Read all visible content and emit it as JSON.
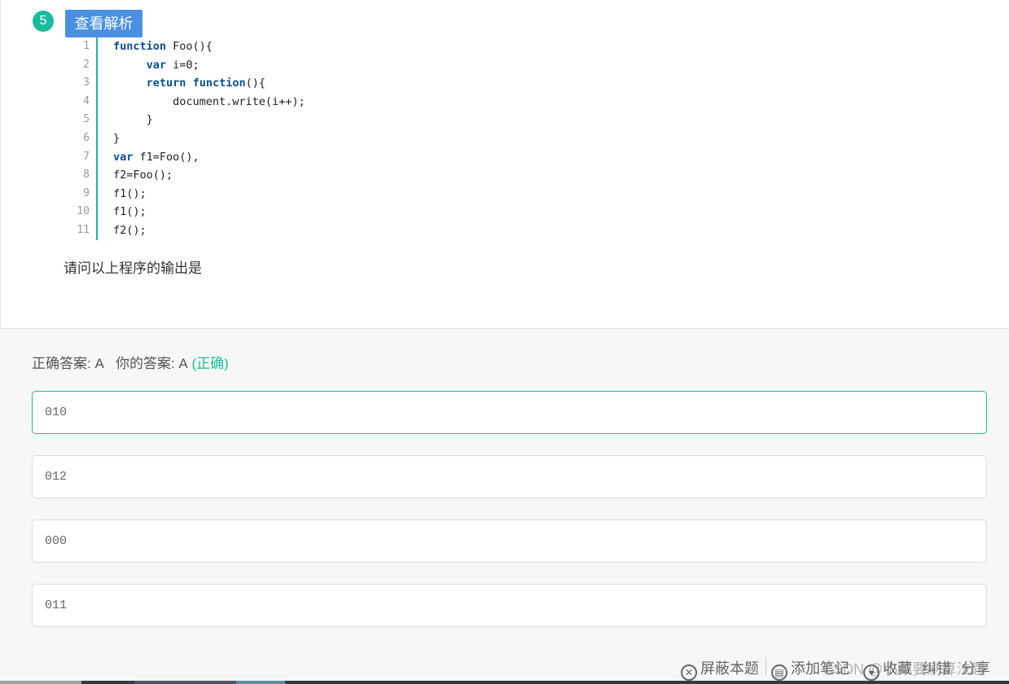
{
  "question": {
    "number": "5",
    "analysis_button": "查看解析",
    "code_line_numbers": [
      "1",
      "2",
      "3",
      "4",
      "5",
      "6",
      "7",
      "8",
      "9",
      "10",
      "11"
    ],
    "code": [
      [
        {
          "t": "function",
          "k": true
        },
        {
          "t": " Foo(){",
          "k": false
        }
      ],
      [
        {
          "t": "     ",
          "k": false
        },
        {
          "t": "var",
          "k": true
        },
        {
          "t": " i=0;",
          "k": false
        }
      ],
      [
        {
          "t": "     ",
          "k": false
        },
        {
          "t": "return",
          "k": true
        },
        {
          "t": " ",
          "k": false
        },
        {
          "t": "function",
          "k": true
        },
        {
          "t": "(){",
          "k": false
        }
      ],
      [
        {
          "t": "         document.write(i++);",
          "k": false
        }
      ],
      [
        {
          "t": "     }",
          "k": false
        }
      ],
      [
        {
          "t": "}",
          "k": false
        }
      ],
      [
        {
          "t": "var",
          "k": true
        },
        {
          "t": " f1=Foo(),",
          "k": false
        }
      ],
      [
        {
          "t": "f2=Foo();",
          "k": false
        }
      ],
      [
        {
          "t": "f1();",
          "k": false
        }
      ],
      [
        {
          "t": "f1();",
          "k": false
        }
      ],
      [
        {
          "t": "f2();",
          "k": false
        }
      ]
    ],
    "prompt": "请问以上程序的输出是"
  },
  "answer": {
    "correct_label": "正确答案: A",
    "your_label": "你的答案: A",
    "result": "(正确)"
  },
  "options": [
    {
      "text": "010",
      "selected": true
    },
    {
      "text": "012",
      "selected": false
    },
    {
      "text": "000",
      "selected": false
    },
    {
      "text": "011",
      "selected": false
    }
  ],
  "actions": {
    "block": "屏蔽本题",
    "note": "添加笔记",
    "favorite": "收藏",
    "error": "纠错",
    "share": "分享"
  },
  "watermark": "CSDN @小菜要刷算法题",
  "colors": {
    "accent": "#1abc9c",
    "button": "#4a90e2",
    "keyword": "#0b4f8f"
  }
}
